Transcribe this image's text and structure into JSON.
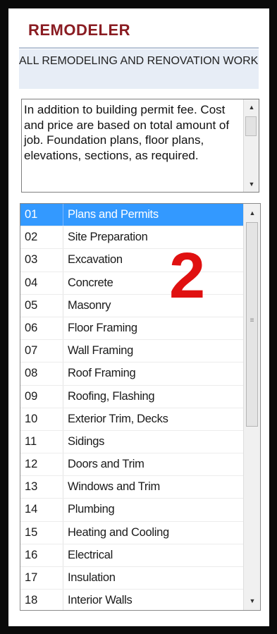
{
  "app": {
    "title": "REMODELER",
    "category": "ALL REMODELING AND RENOVATION WORK"
  },
  "description": {
    "text": "In addition to building permit fee. Cost and price are based on total amount of job. Foundation plans, floor plans, elevations, sections, as required."
  },
  "list": {
    "selected_index": 0,
    "items": [
      {
        "num": "01",
        "name": "Plans and Permits"
      },
      {
        "num": "02",
        "name": "Site Preparation"
      },
      {
        "num": "03",
        "name": "Excavation"
      },
      {
        "num": "04",
        "name": "Concrete"
      },
      {
        "num": "05",
        "name": "Masonry"
      },
      {
        "num": "06",
        "name": "Floor Framing"
      },
      {
        "num": "07",
        "name": "Wall Framing"
      },
      {
        "num": "08",
        "name": "Roof Framing"
      },
      {
        "num": "09",
        "name": "Roofing, Flashing"
      },
      {
        "num": "10",
        "name": "Exterior Trim, Decks"
      },
      {
        "num": "11",
        "name": "Sidings"
      },
      {
        "num": "12",
        "name": "Doors and Trim"
      },
      {
        "num": "13",
        "name": "Windows and Trim"
      },
      {
        "num": "14",
        "name": "Plumbing"
      },
      {
        "num": "15",
        "name": "Heating and Cooling"
      },
      {
        "num": "16",
        "name": "Electrical"
      },
      {
        "num": "17",
        "name": "Insulation"
      },
      {
        "num": "18",
        "name": "Interior Walls"
      }
    ]
  },
  "annotation": {
    "label": "2"
  },
  "icons": {
    "scroll_up": "scroll-up-arrow-icon",
    "scroll_down": "scroll-down-arrow-icon",
    "grip": "scrollbar-grip-icon"
  },
  "colors": {
    "title": "#8a1c22",
    "selection": "#3399ff",
    "annotation": "#e01010",
    "category_bg": "#e7edf6"
  }
}
